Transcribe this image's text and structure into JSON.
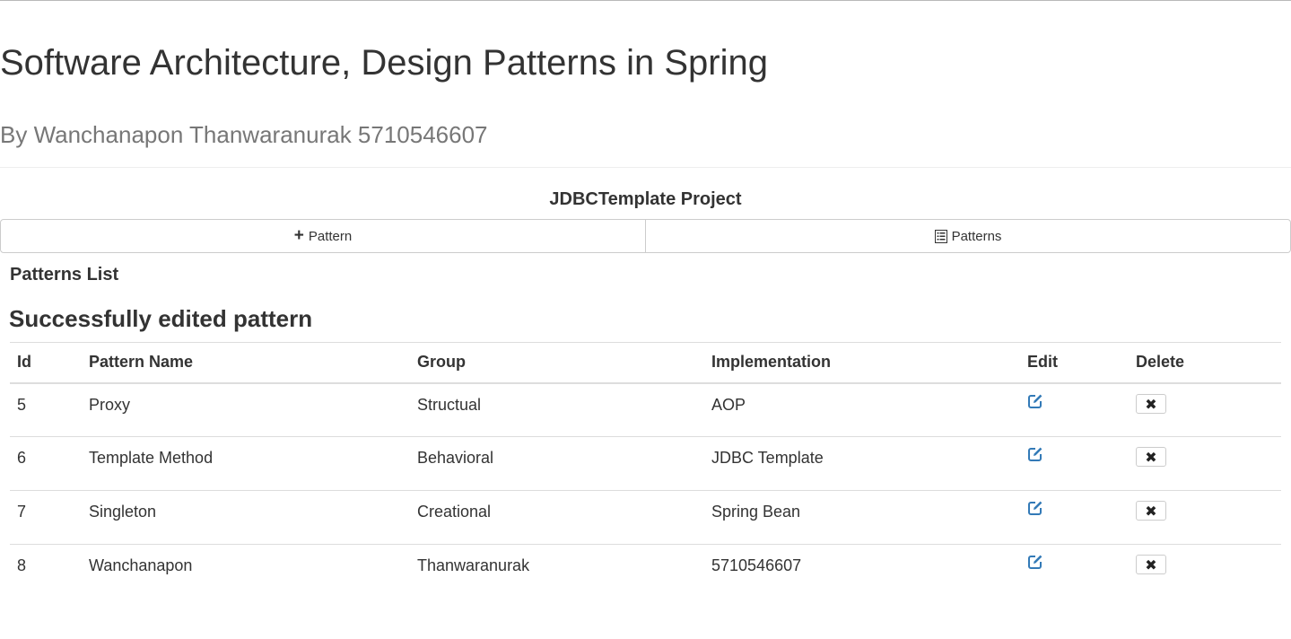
{
  "header": {
    "title": "Software Architecture, Design Patterns in Spring",
    "subtitle": "By Wanchanapon Thanwaranurak 5710546607"
  },
  "project": {
    "title": "JDBCTemplate Project"
  },
  "toolbar": {
    "add_label": "Pattern",
    "add_icon": "plus-icon",
    "list_label": "Patterns",
    "list_icon": "list-icon"
  },
  "list": {
    "heading": "Patterns List",
    "message": "Successfully edited pattern",
    "columns": [
      "Id",
      "Pattern Name",
      "Group",
      "Implementation",
      "Edit",
      "Delete"
    ],
    "rows": [
      {
        "id": "5",
        "name": "Proxy",
        "group": "Structual",
        "implementation": "AOP"
      },
      {
        "id": "6",
        "name": "Template Method",
        "group": "Behavioral",
        "implementation": "JDBC Template"
      },
      {
        "id": "7",
        "name": "Singleton",
        "group": "Creational",
        "implementation": "Spring Bean"
      },
      {
        "id": "8",
        "name": "Wanchanapon",
        "group": "Thanwaranurak",
        "implementation": "5710546607"
      }
    ],
    "edit_icon": "edit-icon",
    "delete_icon": "close-icon"
  },
  "colors": {
    "text": "#333333",
    "muted": "#777777",
    "link": "#337ab7",
    "border": "#dddddd"
  }
}
